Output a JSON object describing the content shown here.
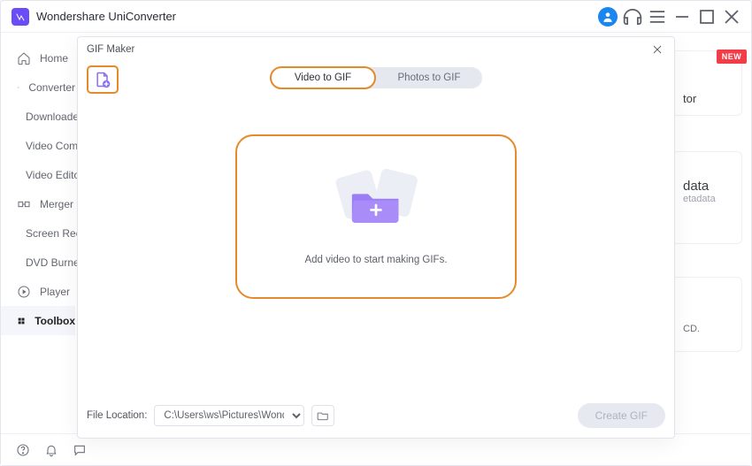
{
  "titlebar": {
    "title": "Wondershare UniConverter"
  },
  "sidebar": {
    "items": [
      {
        "label": "Home"
      },
      {
        "label": "Converter"
      },
      {
        "label": "Downloader"
      },
      {
        "label": "Video Compressor"
      },
      {
        "label": "Video Editor"
      },
      {
        "label": "Merger"
      },
      {
        "label": "Screen Recorder"
      },
      {
        "label": "DVD Burner"
      },
      {
        "label": "Player"
      },
      {
        "label": "Toolbox"
      }
    ]
  },
  "right": {
    "new_badge": "NEW",
    "card1_line": "tor",
    "card2_title": "data",
    "card2_sub": "etadata",
    "card3_line": "CD."
  },
  "modal": {
    "title": "GIF Maker",
    "tabs": [
      {
        "label": "Video to GIF"
      },
      {
        "label": "Photos to GIF"
      }
    ],
    "drop_hint": "Add video to start making GIFs.",
    "file_label": "File Location:",
    "file_path": "C:\\Users\\ws\\Pictures\\Wonders",
    "create_label": "Create GIF"
  }
}
